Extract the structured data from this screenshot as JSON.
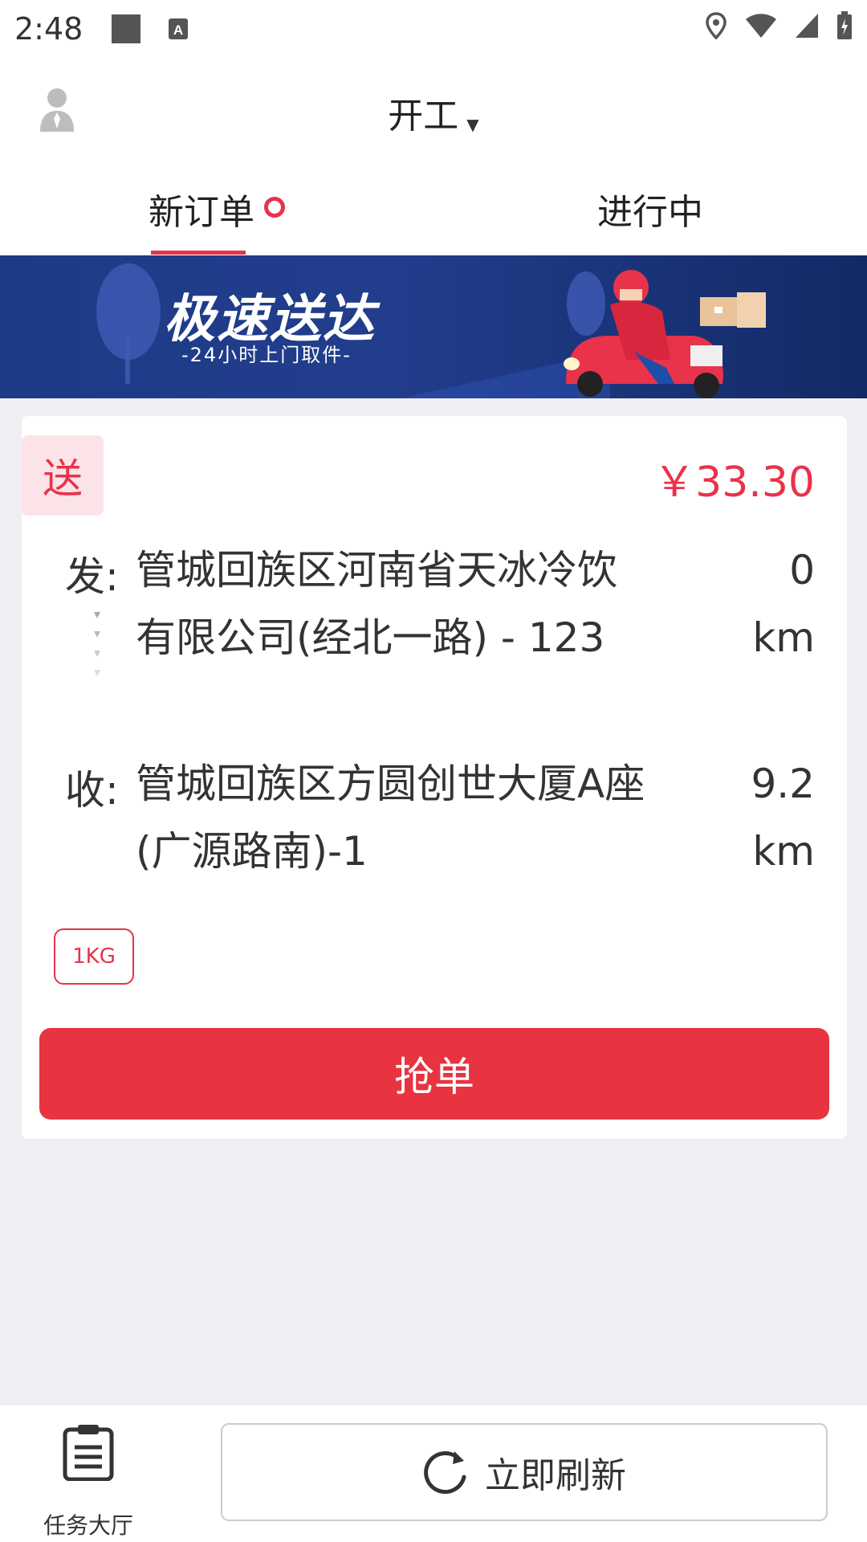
{
  "status_bar": {
    "time": "2:48",
    "icons": [
      "square-icon",
      "keyboard-a-icon",
      "location-icon",
      "wifi-icon",
      "signal-icon",
      "battery-icon"
    ]
  },
  "header": {
    "title": "开工",
    "caret_glyph": "▼",
    "avatar_icon": "user-avatar-icon"
  },
  "tabs": [
    {
      "label": "新订单",
      "active": true,
      "has_dot": true
    },
    {
      "label": "进行中",
      "active": false
    }
  ],
  "banner": {
    "title": "极速送达",
    "subtitle": "-24小时上门取件-"
  },
  "order": {
    "type_badge": "送",
    "price": "￥33.30",
    "from_label": "发:",
    "from_address": "管城回族区河南省天冰冷饮有限公司(经北一路) - 123",
    "from_distance": "0 km",
    "to_label": "收:",
    "to_address": "管城回族区方圆创世大厦A座(广源路南)-1",
    "to_distance": "9.2 km",
    "weight_tag": "1KG",
    "grab_button": "抢单"
  },
  "bottom_nav": {
    "task_hall_label": "任务大厅",
    "refresh_label": "立即刷新"
  },
  "colors": {
    "accent": "#E8334A",
    "button": "#E83340",
    "banner_bg": "#1C3B86",
    "page_bg": "#EFEEF3"
  }
}
